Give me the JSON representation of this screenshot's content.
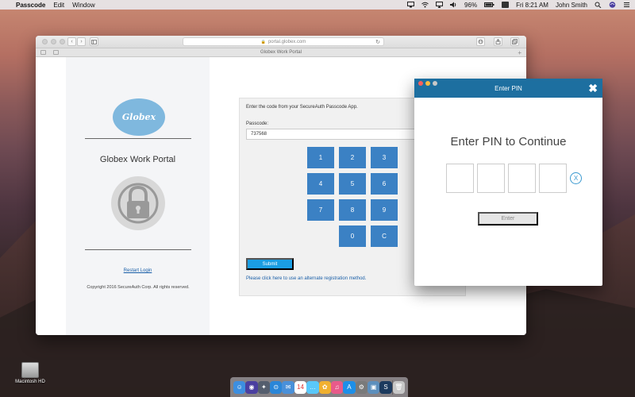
{
  "menubar": {
    "apple_glyph": "",
    "app_name": "Passcode",
    "menus": [
      "Edit",
      "Window"
    ],
    "battery": "96%",
    "clock": "Fri 8:21 AM",
    "user": "John Smith",
    "icons": [
      "display-icon",
      "wifi-icon",
      "airplay-icon",
      "volume-icon",
      "battery-icon",
      "flag-icon",
      "spotlight-icon",
      "siri-icon",
      "menu-icon"
    ]
  },
  "browser": {
    "url": "portal.globex.com",
    "tab_title": "Globex Work Portal",
    "back_glyph": "‹",
    "forward_glyph": "›",
    "reload_glyph": "↻",
    "new_tab_glyph": "+"
  },
  "portal": {
    "logo_text": "Globex",
    "title": "Globex Work Portal",
    "restart_link": "Restart Login",
    "copyright": "Copyright 2016 SecureAuth Corp. All rights reserved.",
    "instruction": "Enter the code from your SecureAuth Passcode App.",
    "passcode_label": "Passcode:",
    "passcode_value": "737568",
    "keypad": [
      "1",
      "2",
      "3",
      "4",
      "5",
      "6",
      "7",
      "8",
      "9",
      "0",
      "C"
    ],
    "submit_label": "Submit",
    "alt_link": "Please click here to use an alternate registration method."
  },
  "pin_dialog": {
    "window_title": "Enter PIN",
    "close_glyph": "✖",
    "heading": "Enter PIN to Continue",
    "clear_glyph": "X",
    "enter_label": "Enter",
    "colors": {
      "header": "#1d6fa0",
      "accent": "#3b9ad0"
    }
  },
  "desktop": {
    "hd_label": "Macintosh HD"
  },
  "dock": {
    "apps": [
      {
        "name": "finder-icon",
        "glyph": "☺",
        "color": "#3d8fe0"
      },
      {
        "name": "siri-icon",
        "glyph": "◉",
        "color": "#4b3fa0"
      },
      {
        "name": "launchpad-icon",
        "glyph": "✦",
        "color": "#555e6e"
      },
      {
        "name": "safari-icon",
        "glyph": "⊙",
        "color": "#2a86d8"
      },
      {
        "name": "mail-icon",
        "glyph": "✉",
        "color": "#4a90d9"
      },
      {
        "name": "calendar-icon",
        "glyph": "14",
        "color": "#ffffff"
      },
      {
        "name": "messages-icon",
        "glyph": "…",
        "color": "#5ac8fa"
      },
      {
        "name": "photos-icon",
        "glyph": "✿",
        "color": "#f0b030"
      },
      {
        "name": "itunes-icon",
        "glyph": "♫",
        "color": "#e85a8a"
      },
      {
        "name": "appstore-icon",
        "glyph": "A",
        "color": "#1d8fe8"
      },
      {
        "name": "system-preferences-icon",
        "glyph": "⚙",
        "color": "#7a7a7a"
      },
      {
        "name": "preview-icon",
        "glyph": "▣",
        "color": "#5d8fbd"
      },
      {
        "name": "passcode-icon",
        "glyph": "S",
        "color": "#1c3a5e"
      },
      {
        "name": "trash-icon",
        "glyph": "🗑",
        "color": "#c7c7c7"
      }
    ]
  }
}
